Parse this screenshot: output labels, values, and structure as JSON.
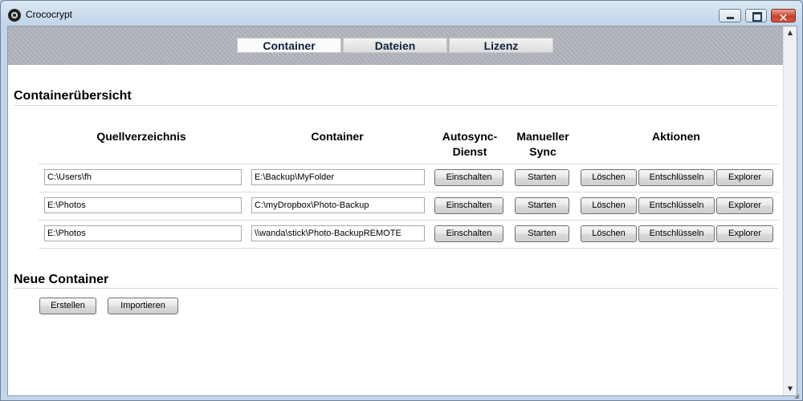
{
  "window": {
    "title": "Crococrypt"
  },
  "tabs": [
    {
      "label": "Container"
    },
    {
      "label": "Dateien"
    },
    {
      "label": "Lizenz"
    }
  ],
  "overview": {
    "title": "Containerübersicht",
    "columns": {
      "source": "Quellverzeichnis",
      "container": "Container",
      "autosync_line1": "Autosync-",
      "autosync_line2": "Dienst",
      "manual_line1": "Manueller",
      "manual_line2": "Sync",
      "actions": "Aktionen"
    },
    "rows": [
      {
        "source": "C:\\Users\\fh",
        "container": "E:\\Backup\\MyFolder",
        "autosync": "Einschalten",
        "manual": "Starten",
        "delete": "Löschen",
        "decrypt": "Entschlüsseln",
        "explorer": "Explorer"
      },
      {
        "source": "E:\\Photos",
        "container": "C:\\myDropbox\\Photo-Backup",
        "autosync": "Einschalten",
        "manual": "Starten",
        "delete": "Löschen",
        "decrypt": "Entschlüsseln",
        "explorer": "Explorer"
      },
      {
        "source": "E:\\Photos",
        "container": "\\\\wanda\\stick\\Photo-BackupREMOTE",
        "autosync": "Einschalten",
        "manual": "Starten",
        "delete": "Löschen",
        "decrypt": "Entschlüsseln",
        "explorer": "Explorer"
      }
    ]
  },
  "new_container": {
    "title": "Neue Container",
    "create_label": "Erstellen",
    "import_label": "Importieren"
  },
  "icons": {
    "app": "crococrypt-logo-icon",
    "minimize": "minimize-icon",
    "maximize": "maximize-icon",
    "close": "close-icon",
    "scroll_up": "scroll-up-arrow-icon",
    "scroll_down": "scroll-down-arrow-icon"
  },
  "colors": {
    "tab_text": "#0d2240",
    "banner": "#b0b3ba",
    "close_button": "#c7422b"
  }
}
